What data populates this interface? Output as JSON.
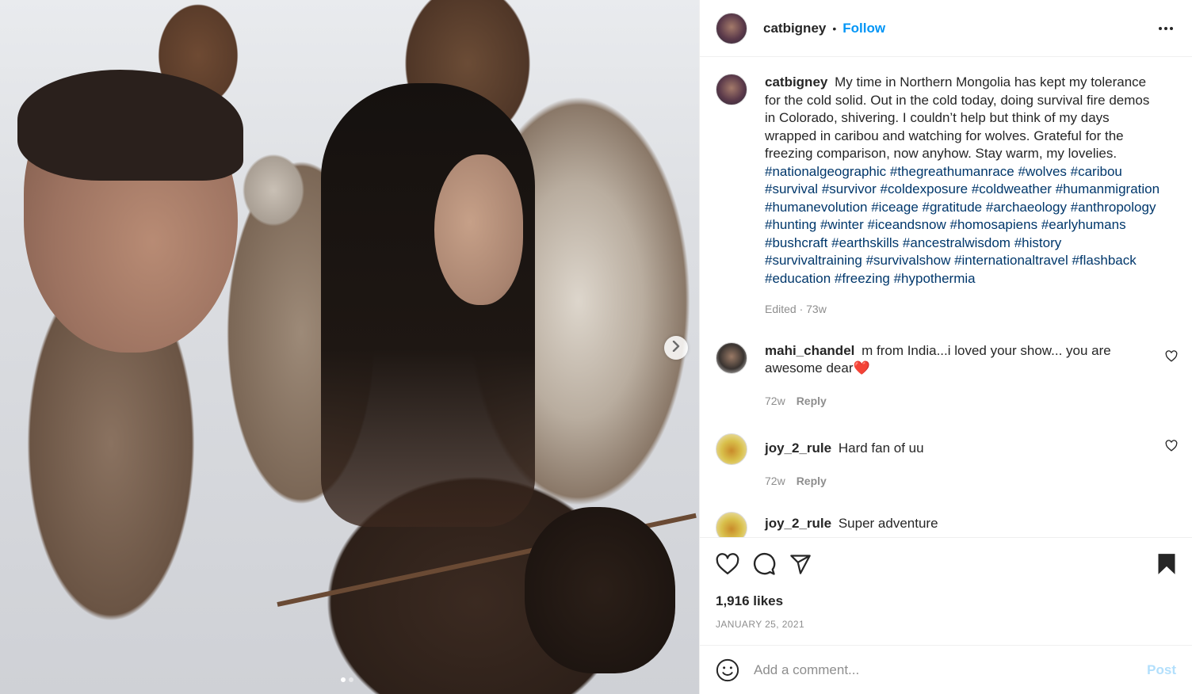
{
  "post": {
    "author": "catbigney",
    "follow_label": "Follow",
    "separator": "•",
    "caption_text": "My time in Northern Mongolia has kept my tolerance for the cold solid. Out in the cold today, doing survival fire demos in Colorado, shivering. I couldn’t help but think of my days wrapped in caribou and watching for wolves. Grateful for the freezing comparison, now anyhow. Stay warm, my lovelies.",
    "hashtags": [
      "#nationalgeographic",
      "#thegreathumanrace",
      "#wolves",
      "#caribou",
      "#survival",
      "#survivor",
      "#coldexposure",
      "#coldweather",
      "#humanmigration",
      "#humanevolution",
      "#iceage",
      "#gratitude",
      "#archaeology",
      "#anthropology",
      "#hunting",
      "#winter",
      "#iceandsnow",
      "#homosapiens",
      "#earlyhumans",
      "#bushcraft",
      "#earthskills",
      "#ancestralwisdom",
      "#history",
      "#survivaltraining",
      "#survivalshow",
      "#internationaltravel",
      "#flashback",
      "#education",
      "#freezing",
      "#hypothermia"
    ],
    "caption_meta": "Edited · 73w",
    "likes": "1,916 likes",
    "date": "JANUARY 25, 2021"
  },
  "comments": [
    {
      "username": "mahi_chandel",
      "text": "m from India...i loved your show... you are awesome dear❤️",
      "age": "72w",
      "reply_label": "Reply"
    },
    {
      "username": "joy_2_rule",
      "text": "Hard fan of uu",
      "age": "72w",
      "reply_label": "Reply"
    },
    {
      "username": "joy_2_rule",
      "text": "Super adventure",
      "age": "",
      "reply_label": ""
    }
  ],
  "composer": {
    "placeholder": "Add a comment...",
    "post_label": "Post"
  },
  "carousel": {
    "current": 1,
    "total": 2
  },
  "colors": {
    "accent": "#0095f6",
    "hashtag": "#00376b",
    "muted": "#8e8e8e",
    "post_disabled": "#b2dffc"
  },
  "icons": [
    "chevron-right-icon",
    "more-icon",
    "heart-icon",
    "comment-icon",
    "share-icon",
    "bookmark-icon",
    "emoji-icon"
  ]
}
